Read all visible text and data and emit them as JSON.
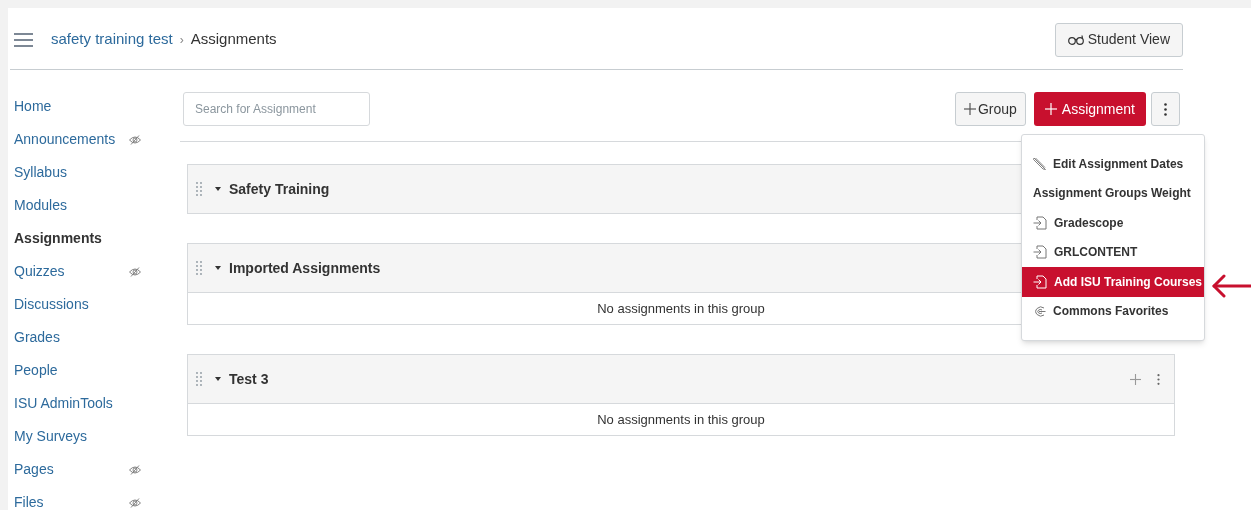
{
  "breadcrumb": {
    "course": "safety training test",
    "separator": "›",
    "current": "Assignments"
  },
  "student_view_button": "Student View",
  "sidebar": {
    "items": [
      {
        "label": "Home",
        "selected": false,
        "hidden": false
      },
      {
        "label": "Announcements",
        "selected": false,
        "hidden": true
      },
      {
        "label": "Syllabus",
        "selected": false,
        "hidden": false
      },
      {
        "label": "Modules",
        "selected": false,
        "hidden": false
      },
      {
        "label": "Assignments",
        "selected": true,
        "hidden": false
      },
      {
        "label": "Quizzes",
        "selected": false,
        "hidden": true
      },
      {
        "label": "Discussions",
        "selected": false,
        "hidden": false
      },
      {
        "label": "Grades",
        "selected": false,
        "hidden": false
      },
      {
        "label": "People",
        "selected": false,
        "hidden": false
      },
      {
        "label": "ISU AdminTools",
        "selected": false,
        "hidden": false
      },
      {
        "label": "My Surveys",
        "selected": false,
        "hidden": false
      },
      {
        "label": "Pages",
        "selected": false,
        "hidden": true
      },
      {
        "label": "Files",
        "selected": false,
        "hidden": true
      }
    ]
  },
  "search": {
    "placeholder": "Search for Assignment"
  },
  "toolbar": {
    "group_button": "Group",
    "assignment_button": "Assignment"
  },
  "groups": [
    {
      "title": "Safety Training",
      "expanded": true,
      "show_actions": false
    },
    {
      "title": "Imported Assignments",
      "expanded": true,
      "show_actions": false,
      "empty_text": "No assignments in this group"
    },
    {
      "title": "Test 3",
      "expanded": true,
      "show_actions": true,
      "empty_text": "No assignments in this group"
    }
  ],
  "menu": {
    "items": [
      {
        "label": "Edit Assignment Dates",
        "kind": "pencil",
        "selected": false
      },
      {
        "label": "Assignment Groups Weight",
        "kind": "plain",
        "selected": false
      },
      {
        "label": "Gradescope",
        "kind": "tool",
        "selected": false
      },
      {
        "label": "GRLCONTENT",
        "kind": "tool",
        "selected": false
      },
      {
        "label": "Add ISU Training Courses",
        "kind": "tool",
        "selected": true
      },
      {
        "label": "Commons Favorites",
        "kind": "commons",
        "selected": false
      }
    ]
  }
}
